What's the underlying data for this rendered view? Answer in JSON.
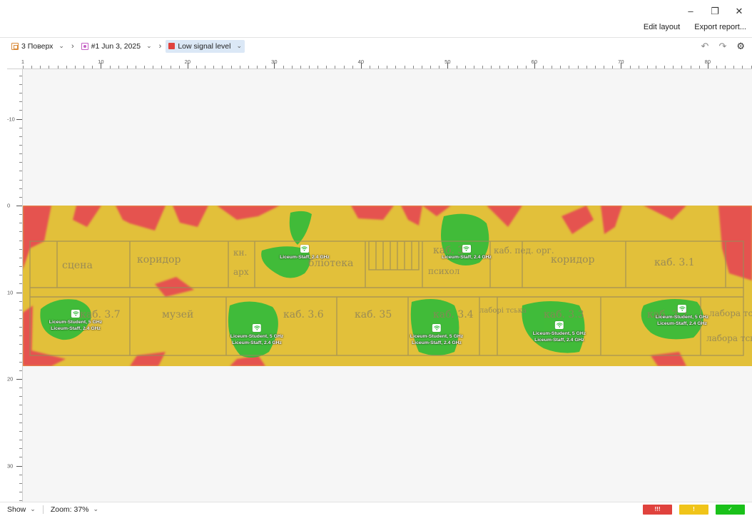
{
  "window": {
    "minimize": "–",
    "restore": "❐",
    "close": "✕"
  },
  "top_actions": {
    "edit_layout": "Edit layout",
    "export_report": "Export report..."
  },
  "breadcrumb": {
    "floor": "3 Поверх",
    "snapshot": "#1 Jun 3, 2025",
    "visualization": "Low signal level"
  },
  "toolbar_right": {
    "undo": "↶",
    "redo": "↷",
    "settings": "⚙"
  },
  "ruler": {
    "x_labels": [
      "1",
      "10",
      "20",
      "30",
      "40",
      "50",
      "60",
      "70",
      "80"
    ],
    "y_labels": [
      "-10",
      "0",
      "10",
      "20",
      "30"
    ]
  },
  "rooms": [
    "сцена",
    "коридор",
    "кн.",
    "арх",
    "бліотека",
    "каб. 3",
    "психол",
    "каб. пед. орг.",
    "коридор",
    "каб. 3.1",
    "каб. 3.7",
    "музей",
    "каб. 3.6",
    "каб. 35",
    "каб. 3.4",
    "лаборі тська",
    "каб. 3.3",
    "каб. 3.2",
    "лабора тська",
    "лабора тська"
  ],
  "access_points": [
    {
      "ssids": [
        "Liceum-Staff, 2.4 GHz"
      ]
    },
    {
      "ssids": [
        "Liceum-Staff, 2.4 GHz"
      ]
    },
    {
      "ssids": [
        "Liceum-Student, 5 GHz",
        "Liceum-Staff, 2.4 GHz"
      ]
    },
    {
      "ssids": [
        "Liceum-Student, 5 GHz",
        "Liceum-Staff, 2.4 GHz"
      ]
    },
    {
      "ssids": [
        "Liceum-Student, 5 GHz",
        "Liceum-Staff, 2.4 GHz"
      ]
    },
    {
      "ssids": [
        "Liceum-Student, 5 GHz",
        "Liceum-Staff, 2.4 GHz"
      ]
    },
    {
      "ssids": [
        "Liceum-Student, 5 GHz",
        "Liceum-Staff, 2.4 GHz"
      ]
    }
  ],
  "status": {
    "show": "Show",
    "zoom": "Zoom: 37%"
  },
  "legend": {
    "bad": "!!!",
    "warn": "!",
    "good": "✓"
  },
  "colors": {
    "bad": "#e0423d",
    "warn": "#f0c419",
    "good": "#1ac11a",
    "heat_yellow": "#e2c03a",
    "heat_red": "#e55350",
    "heat_green": "#33bb3a"
  }
}
